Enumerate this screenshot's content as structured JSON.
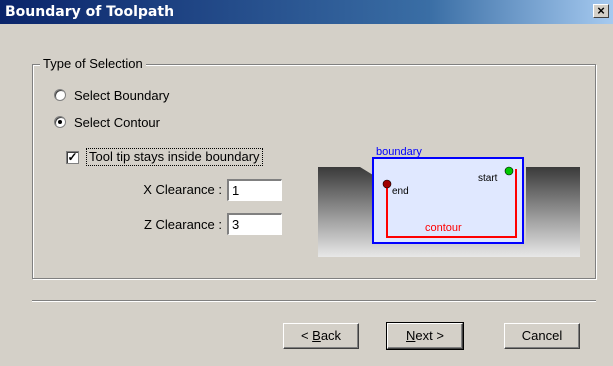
{
  "window": {
    "title": "Boundary of Toolpath",
    "close_glyph": "×"
  },
  "group": {
    "legend": "Type of Selection",
    "radios": [
      {
        "label": "Select Boundary",
        "checked": false
      },
      {
        "label": "Select Contour",
        "checked": true
      }
    ],
    "checkbox": {
      "label": "Tool tip stays inside boundary",
      "checked": true,
      "glyph": "✓"
    },
    "x_clearance": {
      "label": "X Clearance :",
      "value": "1"
    },
    "z_clearance": {
      "label": "Z Clearance :",
      "value": "3"
    }
  },
  "diagram": {
    "boundary_label": "boundary",
    "start_label": "start",
    "end_label": "end",
    "contour_label": "contour",
    "colors": {
      "boundary": "#0000ff",
      "contour": "#ff0000",
      "start_point": "#00c800",
      "end_point": "#a00000",
      "fill": "#e0e8ff"
    }
  },
  "buttons": {
    "back": {
      "pre": "< ",
      "accel": "B",
      "post": "ack"
    },
    "next": {
      "accel": "N",
      "post": "ext >"
    },
    "cancel": {
      "label": "Cancel"
    }
  }
}
